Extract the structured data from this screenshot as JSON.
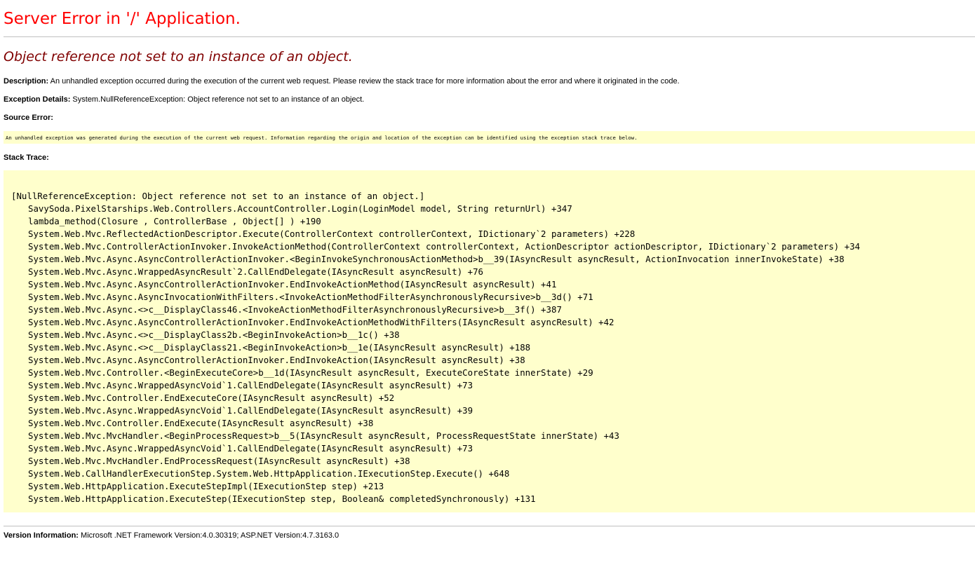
{
  "header": {
    "title": "Server Error in '/' Application.",
    "subtitle": "Object reference not set to an instance of an object."
  },
  "description": {
    "label": "Description:",
    "text": "An unhandled exception occurred during the execution of the current web request. Please review the stack trace for more information about the error and where it originated in the code."
  },
  "exception_details": {
    "label": "Exception Details:",
    "text": "System.NullReferenceException: Object reference not set to an instance of an object."
  },
  "source_error": {
    "label": "Source Error:",
    "text": "An unhandled exception was generated during the execution of the current web request. Information regarding the origin and location of the exception can be identified using the exception stack trace below."
  },
  "stack_trace": {
    "label": "Stack Trace:",
    "header_line": "[NullReferenceException: Object reference not set to an instance of an object.]",
    "lines": [
      "SavySoda.PixelStarships.Web.Controllers.AccountController.Login(LoginModel model, String returnUrl) +347",
      "lambda_method(Closure , ControllerBase , Object[] ) +190",
      "System.Web.Mvc.ReflectedActionDescriptor.Execute(ControllerContext controllerContext, IDictionary`2 parameters) +228",
      "System.Web.Mvc.ControllerActionInvoker.InvokeActionMethod(ControllerContext controllerContext, ActionDescriptor actionDescriptor, IDictionary`2 parameters) +34",
      "System.Web.Mvc.Async.AsyncControllerActionInvoker.<BeginInvokeSynchronousActionMethod>b__39(IAsyncResult asyncResult, ActionInvocation innerInvokeState) +38",
      "System.Web.Mvc.Async.WrappedAsyncResult`2.CallEndDelegate(IAsyncResult asyncResult) +76",
      "System.Web.Mvc.Async.AsyncControllerActionInvoker.EndInvokeActionMethod(IAsyncResult asyncResult) +41",
      "System.Web.Mvc.Async.AsyncInvocationWithFilters.<InvokeActionMethodFilterAsynchronouslyRecursive>b__3d() +71",
      "System.Web.Mvc.Async.<>c__DisplayClass46.<InvokeActionMethodFilterAsynchronouslyRecursive>b__3f() +387",
      "System.Web.Mvc.Async.AsyncControllerActionInvoker.EndInvokeActionMethodWithFilters(IAsyncResult asyncResult) +42",
      "System.Web.Mvc.Async.<>c__DisplayClass2b.<BeginInvokeAction>b__1c() +38",
      "System.Web.Mvc.Async.<>c__DisplayClass21.<BeginInvokeAction>b__1e(IAsyncResult asyncResult) +188",
      "System.Web.Mvc.Async.AsyncControllerActionInvoker.EndInvokeAction(IAsyncResult asyncResult) +38",
      "System.Web.Mvc.Controller.<BeginExecuteCore>b__1d(IAsyncResult asyncResult, ExecuteCoreState innerState) +29",
      "System.Web.Mvc.Async.WrappedAsyncVoid`1.CallEndDelegate(IAsyncResult asyncResult) +73",
      "System.Web.Mvc.Controller.EndExecuteCore(IAsyncResult asyncResult) +52",
      "System.Web.Mvc.Async.WrappedAsyncVoid`1.CallEndDelegate(IAsyncResult asyncResult) +39",
      "System.Web.Mvc.Controller.EndExecute(IAsyncResult asyncResult) +38",
      "System.Web.Mvc.MvcHandler.<BeginProcessRequest>b__5(IAsyncResult asyncResult, ProcessRequestState innerState) +43",
      "System.Web.Mvc.Async.WrappedAsyncVoid`1.CallEndDelegate(IAsyncResult asyncResult) +73",
      "System.Web.Mvc.MvcHandler.EndProcessRequest(IAsyncResult asyncResult) +38",
      "System.Web.CallHandlerExecutionStep.System.Web.HttpApplication.IExecutionStep.Execute() +648",
      "System.Web.HttpApplication.ExecuteStepImpl(IExecutionStep step) +213",
      "System.Web.HttpApplication.ExecuteStep(IExecutionStep step, Boolean& completedSynchronously) +131"
    ]
  },
  "version_info": {
    "label": "Version Information:",
    "text": "Microsoft .NET Framework Version:4.0.30319; ASP.NET Version:4.7.3163.0"
  },
  "colors": {
    "title": "#ff0000",
    "subtitle": "#800000",
    "code_background": "#ffffcc",
    "rule": "#c0c0c0"
  }
}
